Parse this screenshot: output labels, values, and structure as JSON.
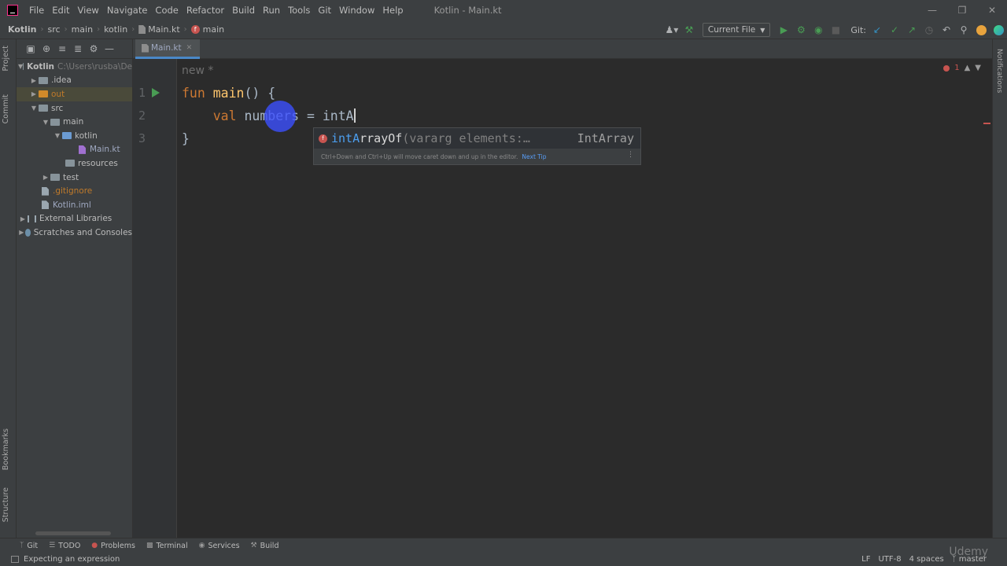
{
  "menubar": {
    "items": [
      "File",
      "Edit",
      "View",
      "Navigate",
      "Code",
      "Refactor",
      "Build",
      "Run",
      "Tools",
      "Git",
      "Window",
      "Help"
    ],
    "title": "Kotlin - Main.kt"
  },
  "breadcrumbs": {
    "project": "Kotlin",
    "src": "src",
    "main": "main",
    "kotlin": "kotlin",
    "file": "Main.kt",
    "func": "main"
  },
  "toolbar": {
    "run_config": "Current File",
    "git_label": "Git:"
  },
  "left_stripe": {
    "project": "Project",
    "commit": "Commit",
    "bookmarks": "Bookmarks",
    "structure": "Structure"
  },
  "right_stripe": {
    "notifications": "Notifications"
  },
  "project_tree": {
    "root_name": "Kotlin",
    "root_path": "C:\\Users\\rusba\\De",
    "idea": ".idea",
    "out": "out",
    "src": "src",
    "main": "main",
    "kotlin": "kotlin",
    "main_kt": "Main.kt",
    "resources": "resources",
    "test": "test",
    "gitignore": ".gitignore",
    "kotlin_iml": "Kotlin.iml",
    "external_libraries": "External Libraries",
    "scratches": "Scratches and Consoles"
  },
  "editor": {
    "tab_label": "Main.kt",
    "hint_new": "new *",
    "line_numbers": [
      "1",
      "2",
      "3"
    ],
    "line1": {
      "kw": "fun",
      "name": "main",
      "rest": "() {"
    },
    "line2": {
      "kw": "val",
      "rest": " numbers = intA"
    },
    "line3": "}",
    "error_count": "1"
  },
  "completion": {
    "match": "intA",
    "name_rest": "rrayOf",
    "params": "(vararg elements:…",
    "type": "IntArray",
    "hint": "Ctrl+Down and Ctrl+Up will move caret down and up in the editor.",
    "next_tip": "Next Tip"
  },
  "bottom_tools": [
    "Git",
    "TODO",
    "Problems",
    "Terminal",
    "Services",
    "Build"
  ],
  "status": {
    "message": "Expecting an expression",
    "line_sep": "LF",
    "encoding": "UTF-8",
    "indent": "4 spaces",
    "branch": "master"
  },
  "watermark": "Udemy",
  "colors": {
    "background": "#2b2b2b",
    "panel": "#3c3f41",
    "keyword": "#cc7832",
    "function": "#ffc66d",
    "error": "#c75450",
    "accent": "#4a88c7"
  }
}
